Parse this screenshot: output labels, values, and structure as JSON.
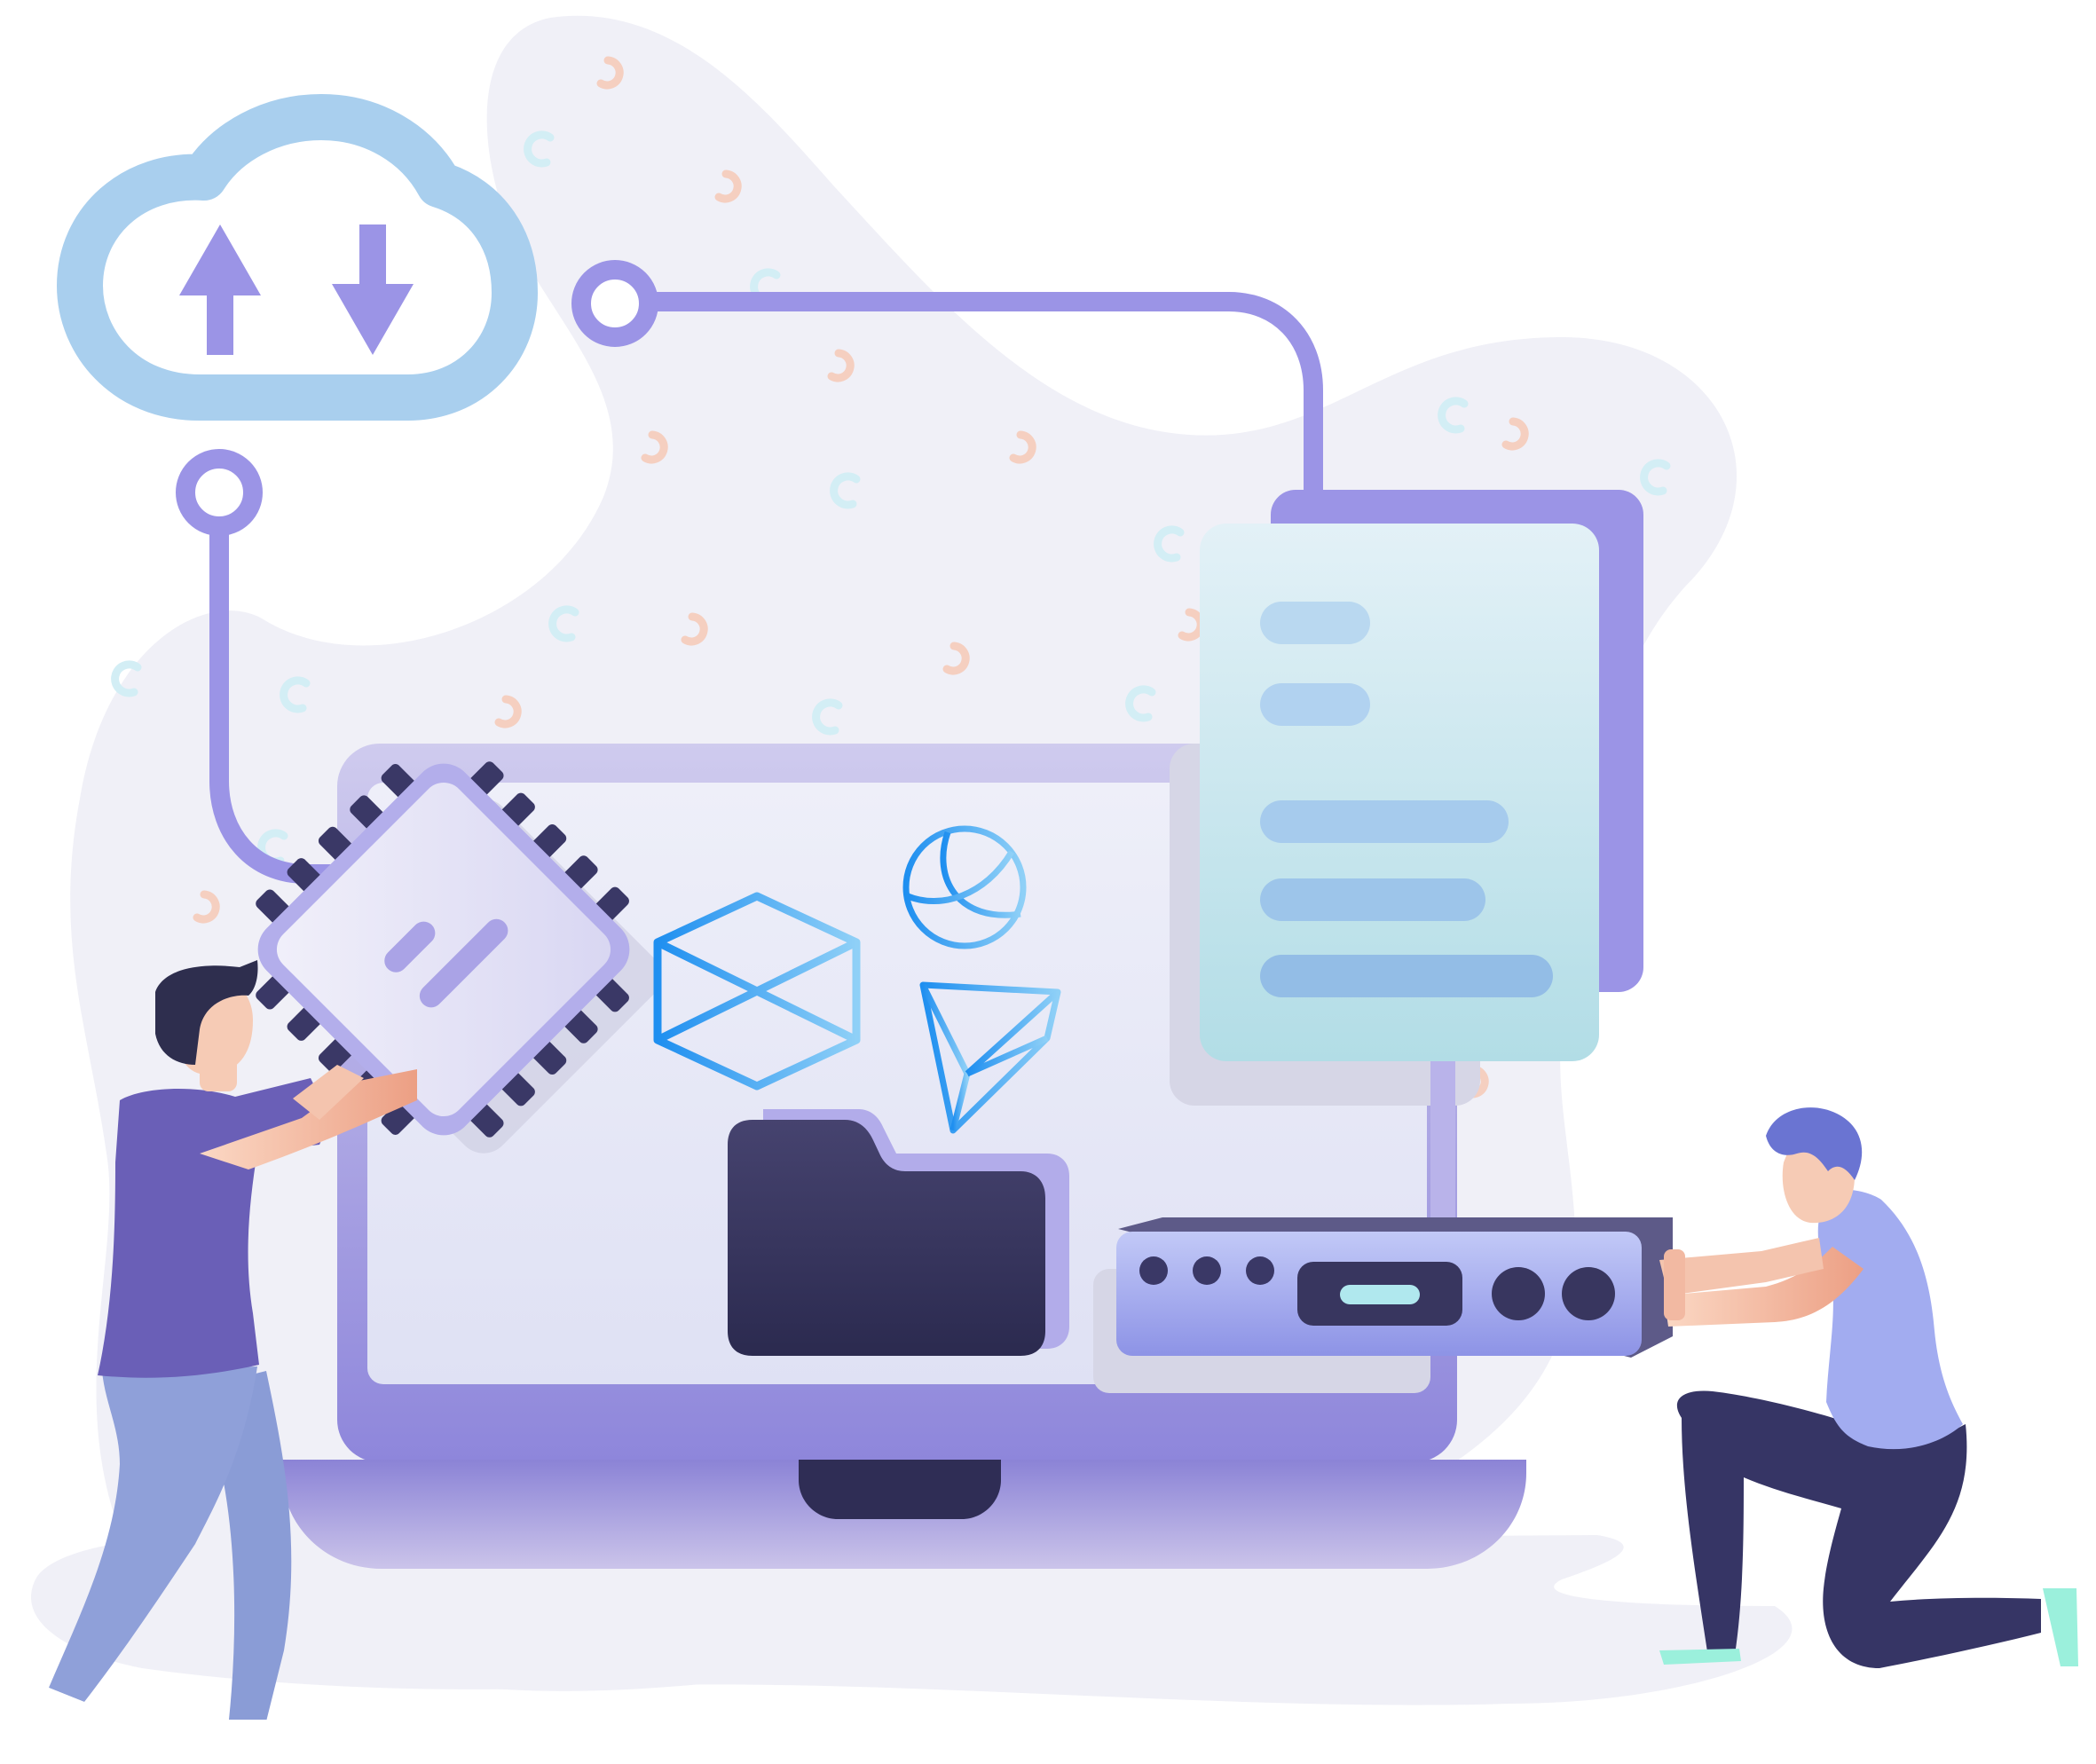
{
  "illustration": {
    "palette": {
      "background": "#ffffff",
      "blob": "#f0f0f7",
      "accent_purple": "#9b94e6",
      "cloud_blue": "#a9cfee",
      "laptop_frame": "#c9c5ec",
      "laptop_screen": "#e8e9f7",
      "document": "#d7eef1",
      "doc_lines": "#9cc3ea",
      "folder_dark": "#3a3866",
      "icon_blue": "#2e9bf0",
      "server": "#a8b0f2",
      "person_left_shirt": "#6a5fb7",
      "person_left_pants": "#8a9cd6",
      "person_right_shirt": "#a2acf0",
      "person_right_pants": "#363565",
      "hair": "#2e2e4e",
      "skin": "#f2b9a2",
      "shoe_mint": "#9bf0dc"
    },
    "icons": [
      "cloud-sync-icon",
      "upload-arrow-icon",
      "download-arrow-icon",
      "cpu-chip-icon",
      "globe-icon",
      "cube-icon",
      "prism-icon",
      "folder-icon",
      "document-icon",
      "server-rack-icon"
    ]
  }
}
